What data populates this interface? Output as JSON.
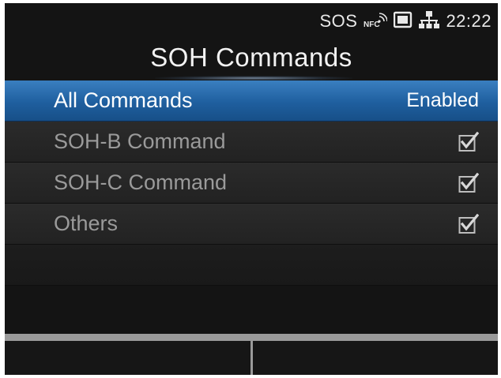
{
  "status": {
    "sos_label": "SOS",
    "nfc_label": "NFC",
    "time": "22:22"
  },
  "header": {
    "title": "SOH Commands"
  },
  "items": [
    {
      "label": "All Commands",
      "value": "Enabled",
      "selected": true
    },
    {
      "label": "SOH-B Command",
      "checked": true
    },
    {
      "label": "SOH-C Command",
      "checked": true
    },
    {
      "label": "Others",
      "checked": true
    }
  ],
  "softkeys": {
    "left_label": "",
    "right_label": ""
  },
  "colors": {
    "selected_row": "#1f5f9f",
    "background": "#141414",
    "softkey_bar": "#9a9a9a"
  }
}
